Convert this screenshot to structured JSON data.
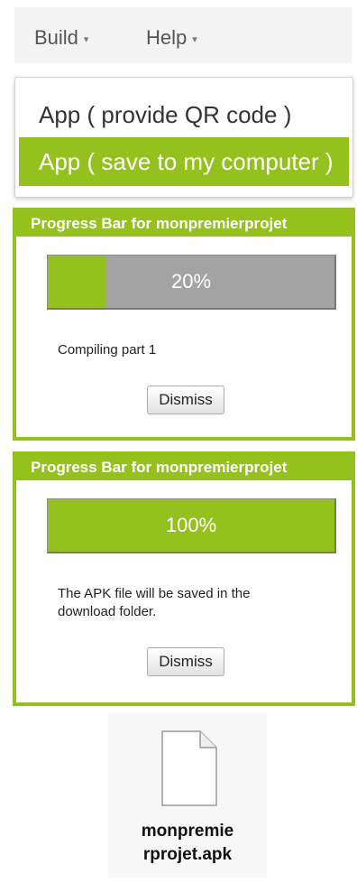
{
  "menubar": {
    "build_label": "Build",
    "help_label": "Help",
    "caret": "▾"
  },
  "dropdown": {
    "items": [
      {
        "label": "App ( provide QR code )"
      },
      {
        "label": "App ( save to my computer )",
        "highlighted": true
      }
    ]
  },
  "dialogs": [
    {
      "title": "Progress Bar for monpremierprojet",
      "progress_percent": 20,
      "progress_label": "20%",
      "message": "Compiling part 1",
      "dismiss_label": "Dismiss"
    },
    {
      "title": "Progress Bar for monpremierprojet",
      "progress_percent": 100,
      "progress_label": "100%",
      "message": "The APK file will be saved in the download folder.",
      "dismiss_label": "Dismiss"
    }
  ],
  "file": {
    "name_line1": "monpremie",
    "name_line2": "rprojet.apk",
    "icon": "document-icon"
  },
  "colors": {
    "accent": "#95c11e",
    "bar_track": "#a3a3a3"
  }
}
